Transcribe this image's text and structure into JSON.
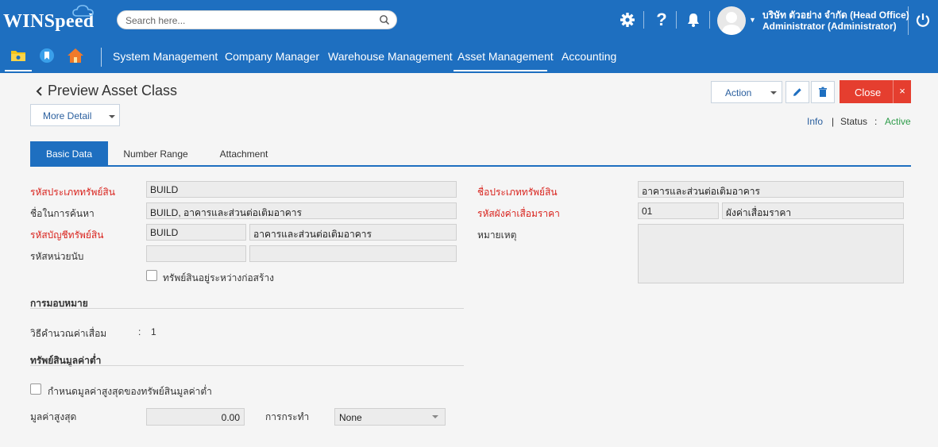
{
  "header": {
    "logo_text": "WINSpeed",
    "search_placeholder": "Search here...",
    "user_company": "บริษัท ตัวอย่าง จำกัด (Head Office)",
    "user_role": "Administrator (Administrator)"
  },
  "nav": {
    "items": [
      "System Management",
      "Company Manager",
      "Warehouse Management",
      "Asset Management",
      "Accounting"
    ],
    "active": "Asset Management"
  },
  "page": {
    "title": "Preview Asset Class",
    "more_detail": "More Detail",
    "action": "Action",
    "close": "Close",
    "close_x": "×",
    "info": "Info",
    "info_sep": "|",
    "status_label": "Status",
    "status_colon": ":",
    "status_value": "Active"
  },
  "tabs": [
    "Basic Data",
    "Number Range",
    "Attachment"
  ],
  "form": {
    "asset_class_code_label": "รหัสประเภททรัพย์สิน",
    "asset_class_code": "BUILD",
    "search_name_label": "ชื่อในการค้นหา",
    "search_name": "BUILD, อาคารและส่วนต่อเติมอาคาร",
    "asset_account_label": "รหัสบัญชีทรัพย์สิน",
    "asset_account_code": "BUILD",
    "asset_account_name": "อาคารและส่วนต่อเติมอาคาร",
    "unit_code_label": "รหัสหน่วยนับ",
    "unit_code": "",
    "unit_name": "",
    "under_construction_label": "ทรัพย์สินอยู่ระหว่างก่อสร้าง",
    "asset_class_name_label": "ชื่อประเภททรัพย์สิน",
    "asset_class_name": "อาคารและส่วนต่อเติมอาคาร",
    "depreciation_chart_label": "รหัสผังค่าเสื่อมราคา",
    "depreciation_chart_code": "01",
    "depreciation_chart_name": "ผังค่าเสื่อมราคา",
    "remark_label": "หมายเหตุ"
  },
  "assignment": {
    "heading": "การมอบหมาย",
    "method_label": "วิธีคำนวณค่าเสื่อม",
    "method_colon": ":",
    "method_value": "1"
  },
  "low_value": {
    "heading": "ทรัพย์สินมูลค่าต่ำ",
    "checkbox_label": "กำหนดมูลค่าสูงสุดของทรัพย์สินมูลค่าต่ำ",
    "max_label": "มูลค่าสูงสุด",
    "max_value": "0.00",
    "action_label": "การกระทำ",
    "action_value": "None"
  },
  "colors": {
    "brand": "#1e6fc0",
    "required": "#d9231d",
    "close": "#e53e2f",
    "active_status": "#2e9c4a"
  }
}
